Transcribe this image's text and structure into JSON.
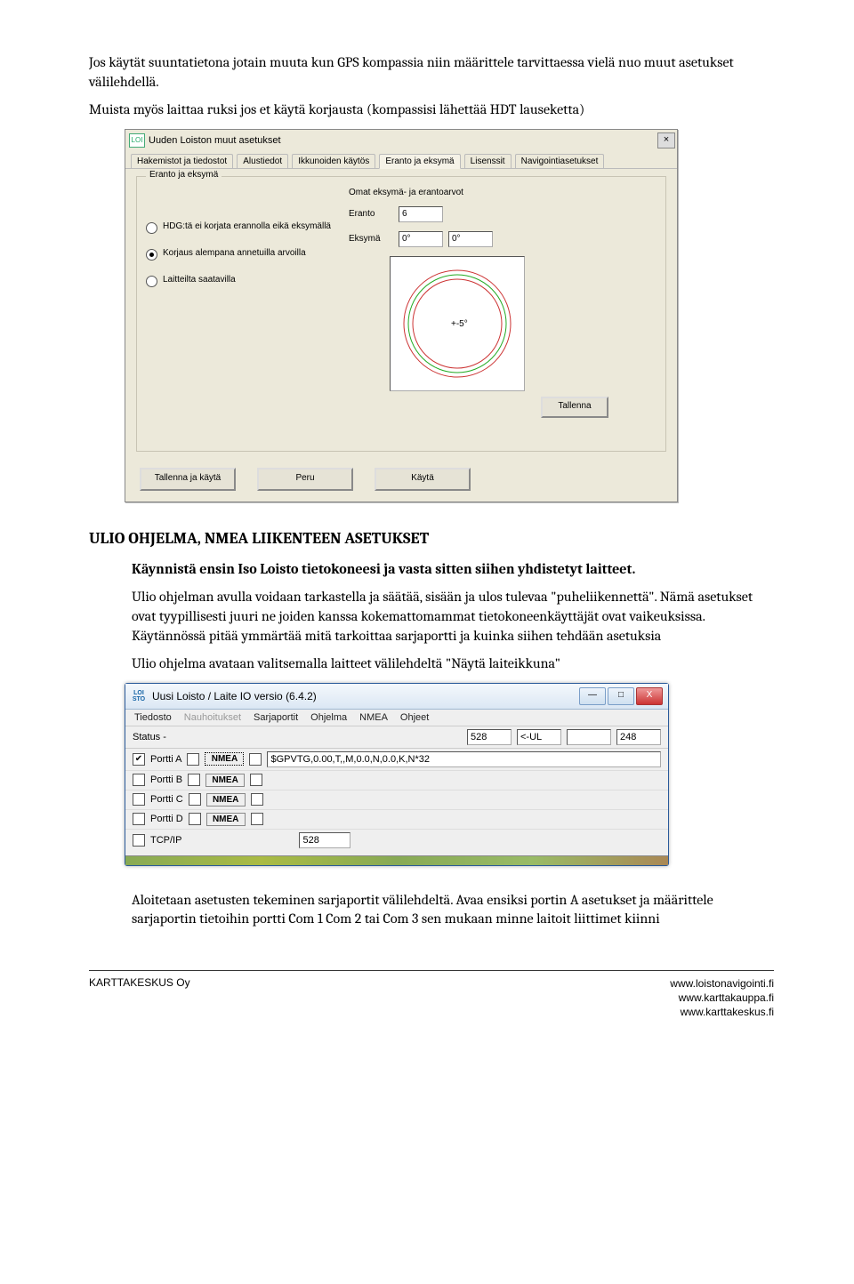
{
  "para_intro_1": "Jos käytät suuntatietona jotain muuta kun GPS kompassia niin määrittele tarvittaessa vielä nuo muut asetukset välilehdellä.",
  "para_intro_2": "Muista myös laittaa ruksi jos et käytä korjausta (kompassisi lähettää HDT lauseketta)",
  "shot1": {
    "logo": "LOI",
    "title": "Uuden Loiston muut asetukset",
    "close": "×",
    "tabs": [
      "Hakemistot ja tiedostot",
      "Alustiedot",
      "Ikkunoiden käytös",
      "Eranto ja eksymä",
      "Lisenssit",
      "Navigointiasetukset"
    ],
    "active_tab": 3,
    "group_legend": "Eranto ja eksymä",
    "radios": [
      "HDG:tä ei korjata erannolla eikä eksymällä",
      "Korjaus alempana annetuilla arvoilla",
      "Laitteilta saatavilla"
    ],
    "selected_radio": 1,
    "subgroup_title": "Omat eksymä- ja erantoarvot",
    "eranto_label": "Eranto",
    "eranto_value": "6",
    "eksyma_label": "Eksymä",
    "eksyma_v1": "0°",
    "eksyma_v2": "0°",
    "compass_deg": "+-5°",
    "btn_tallenna": "Tallenna",
    "footer_buttons": [
      "Tallenna ja käytä",
      "Peru",
      "Käytä"
    ]
  },
  "heading": "ULIO OHJELMA, NMEA LIIKENTEEN ASETUKSET",
  "para_bold": "Käynnistä ensin Iso Loisto tietokoneesi ja vasta sitten siihen yhdistetyt laitteet.",
  "para_mid_1": "Ulio ohjelman avulla voidaan tarkastella ja säätää, sisään ja ulos tulevaa \"puheliikennettä\".  Nämä asetukset ovat tyypillisesti juuri ne joiden kanssa kokemattomammat tietokoneenkäyttäjät ovat vaikeuksissa.  Käytännössä pitää ymmärtää mitä tarkoittaa sarjaportti ja kuinka siihen tehdään asetuksia",
  "para_mid_2": "Ulio ohjelma avataan valitsemalla laitteet välilehdeltä \"Näytä laiteikkuna\"",
  "shot2": {
    "logotext": "LOI\nSTO",
    "title": "Uusi Loisto / Laite IO versio (6.4.2)",
    "min": "—",
    "max": "□",
    "close": "X",
    "menu": [
      "Tiedosto",
      "Nauhoitukset",
      "Sarjaportit",
      "Ohjelma",
      "NMEA",
      "Ohjeet"
    ],
    "menu_disabled_index": 1,
    "status_label": "Status -",
    "status_v1": "528",
    "status_v2": "<-UL",
    "status_v3": "",
    "status_v4": "248",
    "nmea_btn": "NMEA",
    "nmea_line": "$GPVTG,0.00,T,,M,0.0,N,0.0,K,N*32",
    "ports": [
      "Portti A",
      "Portti B",
      "Portti C",
      "Portti D"
    ],
    "port_a_checked": true,
    "tcp_label": "TCP/IP",
    "tcp_val": "528"
  },
  "para_end_1": "Aloitetaan asetusten tekeminen sarjaportit välilehdeltä. Avaa ensiksi portin A asetukset ja määrittele sarjaportin tietoihin portti Com 1 Com 2 tai Com 3 sen mukaan minne laitoit liittimet kiinni",
  "footer": {
    "left": "KARTTAKESKUS Oy",
    "right": [
      "www.loistonavigointi.fi",
      "www.karttakauppa.fi",
      "www.karttakeskus.fi"
    ]
  }
}
